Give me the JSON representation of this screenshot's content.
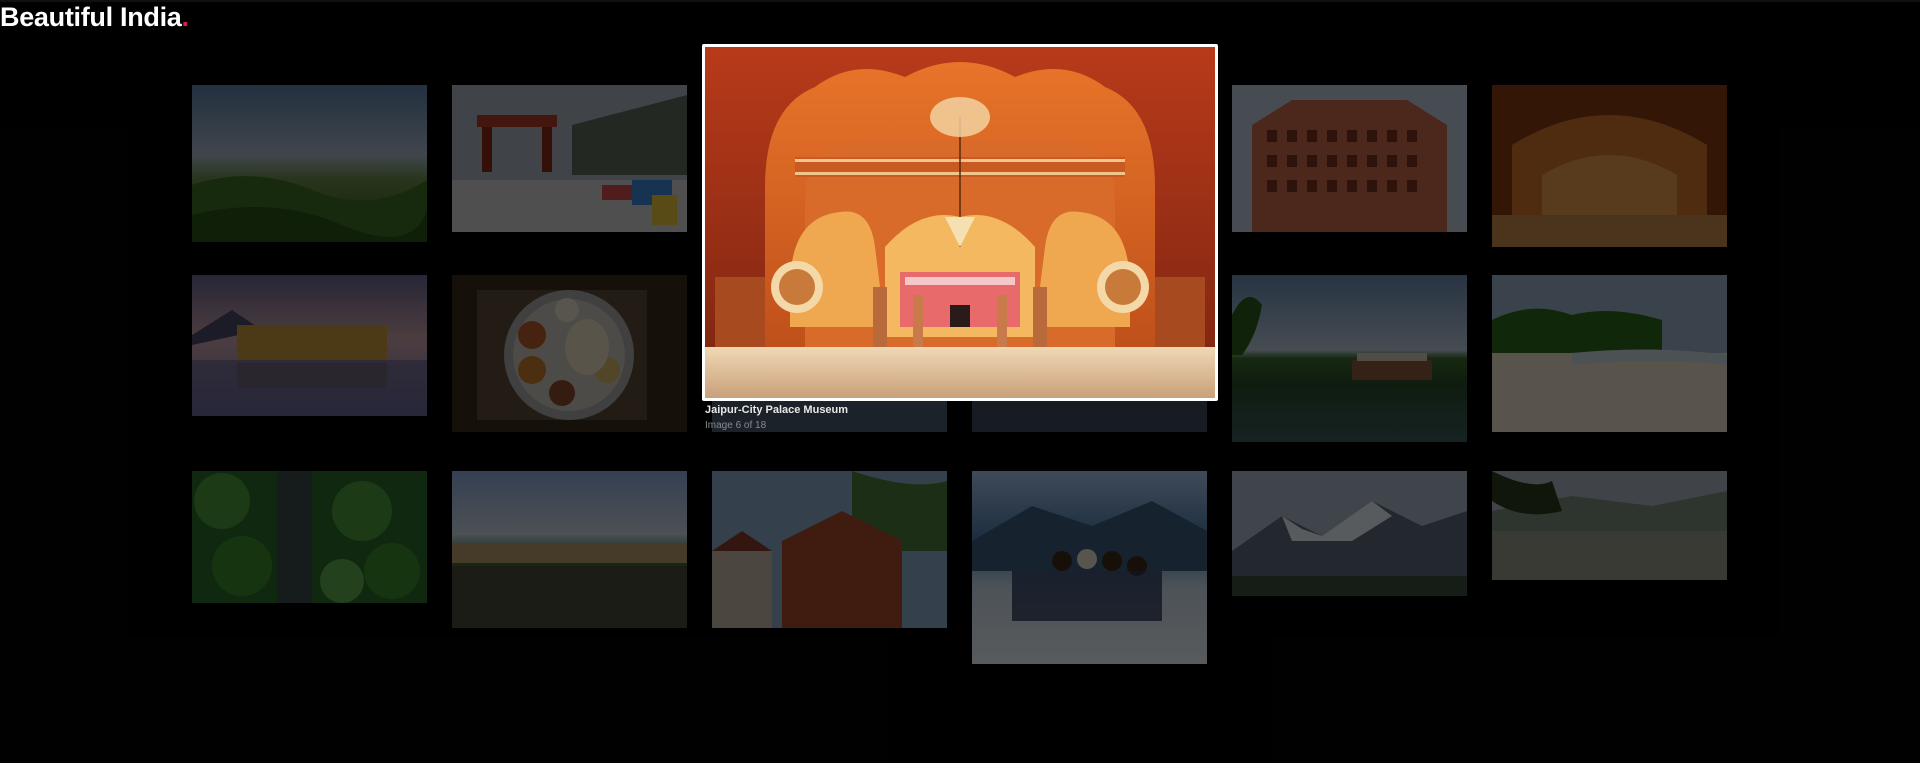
{
  "site": {
    "title": "Beautiful India",
    "title_dot": ".",
    "accent_color": "#d81e4a"
  },
  "gallery": {
    "thumbnails": [
      {
        "subject": "green hills landscape"
      },
      {
        "subject": "monastery gate with prayer flags"
      },
      {
        "subject": "palace arches (active)"
      },
      {
        "subject": "pink palace facade"
      },
      {
        "subject": "palace arches courtyard"
      },
      {
        "subject": "lake palace"
      },
      {
        "subject": "thali plate"
      },
      {
        "subject": "mountain panorama"
      },
      {
        "subject": "houseboat on backwater"
      },
      {
        "subject": "sandy beach with palms"
      },
      {
        "subject": "palm forest aerial"
      },
      {
        "subject": "houseboats in row"
      },
      {
        "subject": "temple rooftops"
      },
      {
        "subject": "group in snow"
      },
      {
        "subject": "snowy mountains"
      },
      {
        "subject": "hill town view"
      }
    ]
  },
  "lightbox": {
    "caption": "Jaipur-City Palace Museum",
    "counter": "Image 6 of 18"
  }
}
